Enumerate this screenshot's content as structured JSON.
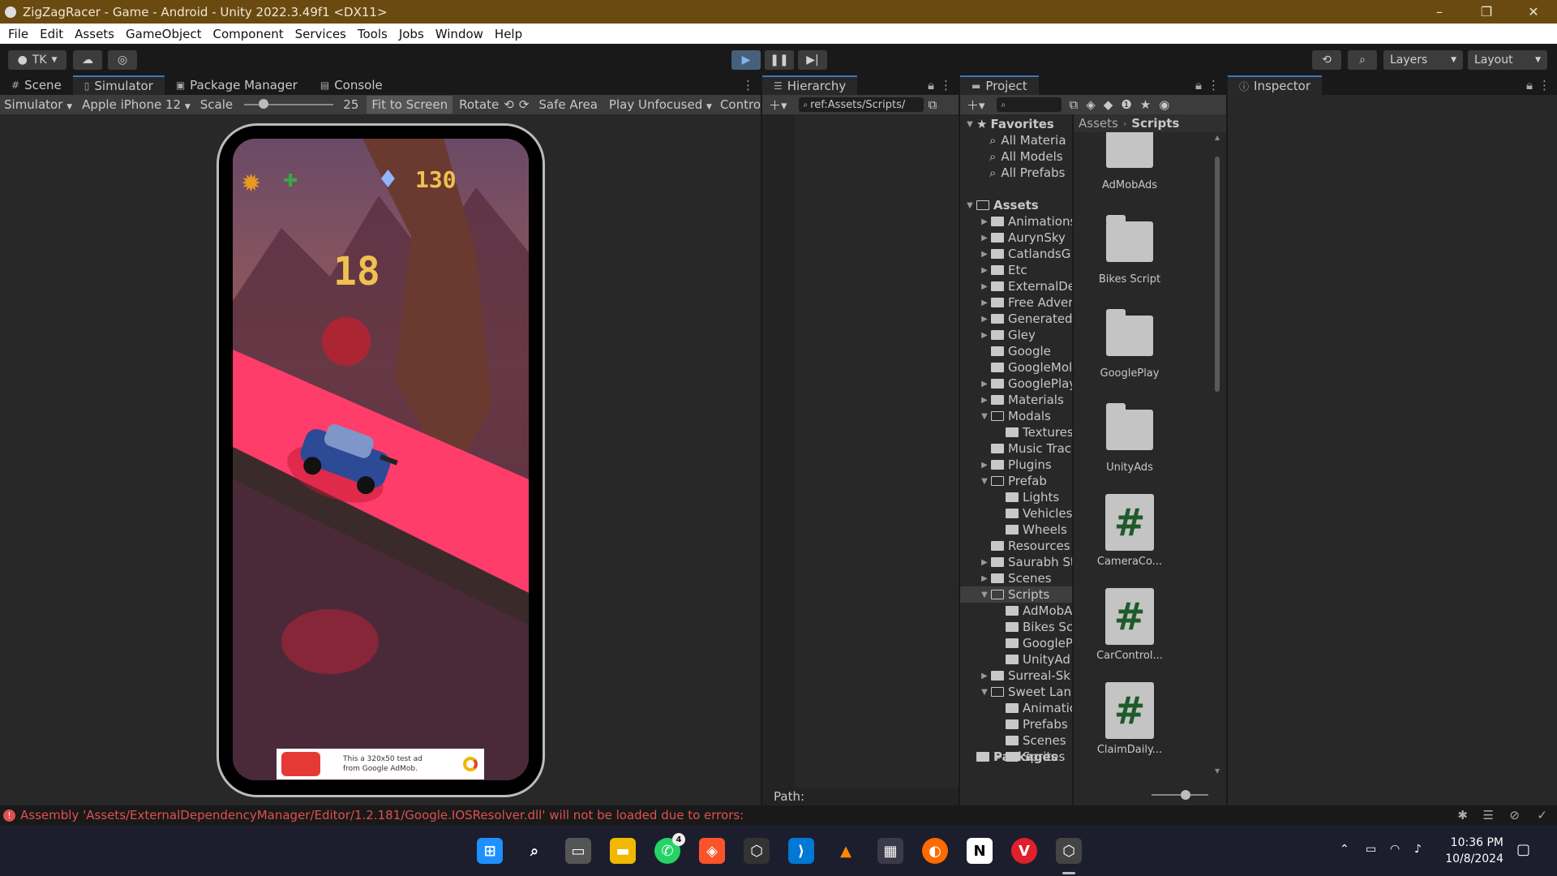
{
  "window": {
    "title": "ZigZagRacer - Game - Android - Unity 2022.3.49f1 <DX11>",
    "controls": [
      "–",
      "❐",
      "✕"
    ]
  },
  "menu": [
    "File",
    "Edit",
    "Assets",
    "GameObject",
    "Component",
    "Services",
    "Tools",
    "Jobs",
    "Window",
    "Help"
  ],
  "toolbar": {
    "account": "TK",
    "layers_label": "Layers",
    "layout_label": "Layout"
  },
  "scene_panel": {
    "tabs": [
      "Scene",
      "Simulator",
      "Package Manager",
      "Console"
    ],
    "simulator_dropdown": "Simulator",
    "device": "Apple iPhone 12",
    "scale_label": "Scale",
    "scale_value": "25",
    "fit_to_screen": "Fit to Screen",
    "rotate": "Rotate",
    "safe_area": "Safe Area",
    "play_mode": "Play Unfocused",
    "control": "Contro"
  },
  "game": {
    "gems": "130",
    "score": "18",
    "ad_text_line1": "This a 320x50 test ad",
    "ad_text_line2": "from Google AdMob."
  },
  "hierarchy": {
    "tab": "Hierarchy",
    "search": "ref:Assets/Scripts/",
    "path_label": "Path:"
  },
  "project": {
    "tab": "Project",
    "breadcrumb": [
      "Assets",
      "Scripts"
    ],
    "favorites_label": "Favorites",
    "favorites": [
      "All Materia",
      "All Models",
      "All Prefabs"
    ],
    "assets_label": "Assets",
    "tree": [
      {
        "label": "Animations",
        "depth": 1,
        "arrow": "▶"
      },
      {
        "label": "AurynSky",
        "depth": 1,
        "arrow": "▶"
      },
      {
        "label": "CatlandsG",
        "depth": 1,
        "arrow": "▶"
      },
      {
        "label": "Etc",
        "depth": 1,
        "arrow": "▶"
      },
      {
        "label": "ExternalDe",
        "depth": 1,
        "arrow": "▶"
      },
      {
        "label": "Free Adver",
        "depth": 1,
        "arrow": "▶"
      },
      {
        "label": "Generated",
        "depth": 1,
        "arrow": "▶"
      },
      {
        "label": "Gley",
        "depth": 1,
        "arrow": "▶"
      },
      {
        "label": "Google",
        "depth": 1,
        "arrow": ""
      },
      {
        "label": "GoogleMol",
        "depth": 1,
        "arrow": ""
      },
      {
        "label": "GooglePlay",
        "depth": 1,
        "arrow": "▶"
      },
      {
        "label": "Materials",
        "depth": 1,
        "arrow": "▶"
      },
      {
        "label": "Modals",
        "depth": 1,
        "arrow": "▼"
      },
      {
        "label": "Textures",
        "depth": 2,
        "arrow": ""
      },
      {
        "label": "Music Trac",
        "depth": 1,
        "arrow": ""
      },
      {
        "label": "Plugins",
        "depth": 1,
        "arrow": "▶"
      },
      {
        "label": "Prefab",
        "depth": 1,
        "arrow": "▼"
      },
      {
        "label": "Lights",
        "depth": 2,
        "arrow": ""
      },
      {
        "label": "Vehicles",
        "depth": 2,
        "arrow": ""
      },
      {
        "label": "Wheels",
        "depth": 2,
        "arrow": ""
      },
      {
        "label": "Resources",
        "depth": 1,
        "arrow": ""
      },
      {
        "label": "Saurabh St",
        "depth": 1,
        "arrow": "▶"
      },
      {
        "label": "Scenes",
        "depth": 1,
        "arrow": "▶"
      },
      {
        "label": "Scripts",
        "depth": 1,
        "arrow": "▼"
      },
      {
        "label": "AdMobA",
        "depth": 2,
        "arrow": ""
      },
      {
        "label": "Bikes Sc",
        "depth": 2,
        "arrow": ""
      },
      {
        "label": "GoogleP",
        "depth": 2,
        "arrow": ""
      },
      {
        "label": "UnityAd",
        "depth": 2,
        "arrow": ""
      },
      {
        "label": "Surreal-Sk",
        "depth": 1,
        "arrow": "▶"
      },
      {
        "label": "Sweet Lan",
        "depth": 1,
        "arrow": "▼"
      },
      {
        "label": "Animatic",
        "depth": 2,
        "arrow": ""
      },
      {
        "label": "Prefabs",
        "depth": 2,
        "arrow": ""
      },
      {
        "label": "Scenes",
        "depth": 2,
        "arrow": ""
      },
      {
        "label": "Sprites",
        "depth": 2,
        "arrow": "▶"
      }
    ],
    "packages_label": "Packages",
    "items": [
      {
        "name": "AdMobAds",
        "kind": "folder"
      },
      {
        "name": "Bikes Script",
        "kind": "folder"
      },
      {
        "name": "GooglePlay",
        "kind": "folder"
      },
      {
        "name": "UnityAds",
        "kind": "folder"
      },
      {
        "name": "CameraCo...",
        "kind": "script"
      },
      {
        "name": "CarControl...",
        "kind": "script"
      },
      {
        "name": "ClaimDaily...",
        "kind": "script"
      }
    ]
  },
  "inspector": {
    "tab": "Inspector"
  },
  "status": {
    "error": "Assembly 'Assets/ExternalDependencyManager/Editor/1.2.181/Google.IOSResolver.dll' will not be loaded due to errors:"
  },
  "taskbar": {
    "time": "10:36 PM",
    "date": "10/8/2024",
    "whatsapp_badge": "4"
  },
  "colors": {
    "title_bar": "#6b4a12",
    "accent": "#3a79bb",
    "error": "#e05050",
    "road": "#ff3d6a"
  }
}
